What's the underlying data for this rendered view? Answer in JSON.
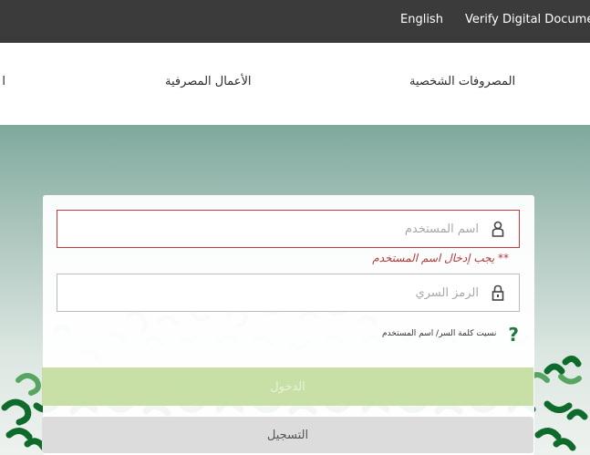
{
  "topbar": {
    "english": "English",
    "verify": "Verify Digital Document"
  },
  "nav": {
    "personal": "المصروفات الشخصية",
    "business": "الأعمال المصرفية",
    "cut": "ا"
  },
  "login": {
    "username_placeholder": "اسم المستخدم",
    "username_error": "** يجب إدخال اسم المستخدم",
    "password_placeholder": "الرمز السري",
    "help_text": "نسيت كلمة السر/ اسم المستخدم",
    "help_icon": "?",
    "login_button": "الدخول",
    "register_button": "التسجيل"
  },
  "colors": {
    "topbar": "#3b3b3b",
    "accent_green": "#1e7a3c",
    "error": "#c53a3a"
  }
}
